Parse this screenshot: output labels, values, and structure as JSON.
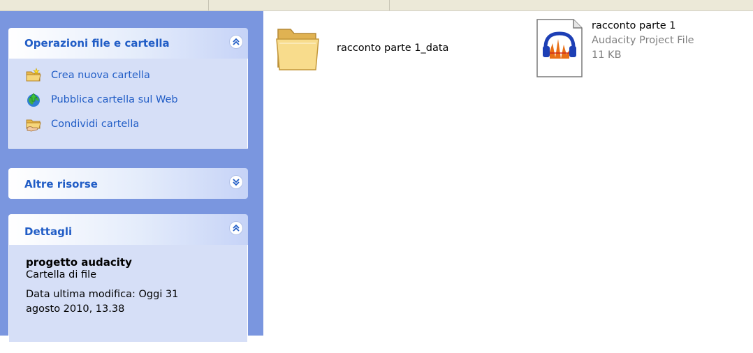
{
  "panels": {
    "file_tasks": {
      "title": "Operazioni file e cartella",
      "items": [
        {
          "label": "Crea nuova cartella",
          "icon": "new-folder-icon"
        },
        {
          "label": "Pubblica cartella sul Web",
          "icon": "publish-web-icon"
        },
        {
          "label": "Condividi cartella",
          "icon": "share-folder-icon"
        }
      ]
    },
    "other_places": {
      "title": "Altre risorse"
    },
    "details": {
      "title": "Dettagli",
      "name": "progetto audacity",
      "type": "Cartella di file",
      "modified": "Data ultima modifica: Oggi 31 agosto 2010, 13.38"
    }
  },
  "files": [
    {
      "name": "racconto parte 1_data",
      "icon": "folder-icon"
    },
    {
      "name": "racconto parte 1",
      "type": "Audacity Project File",
      "size": "11 KB",
      "icon": "audacity-file-icon"
    }
  ],
  "colors": {
    "taskpane_bg": "#7a96df",
    "panel_title": "#215dc6",
    "panel_body": "#d6dff7"
  }
}
